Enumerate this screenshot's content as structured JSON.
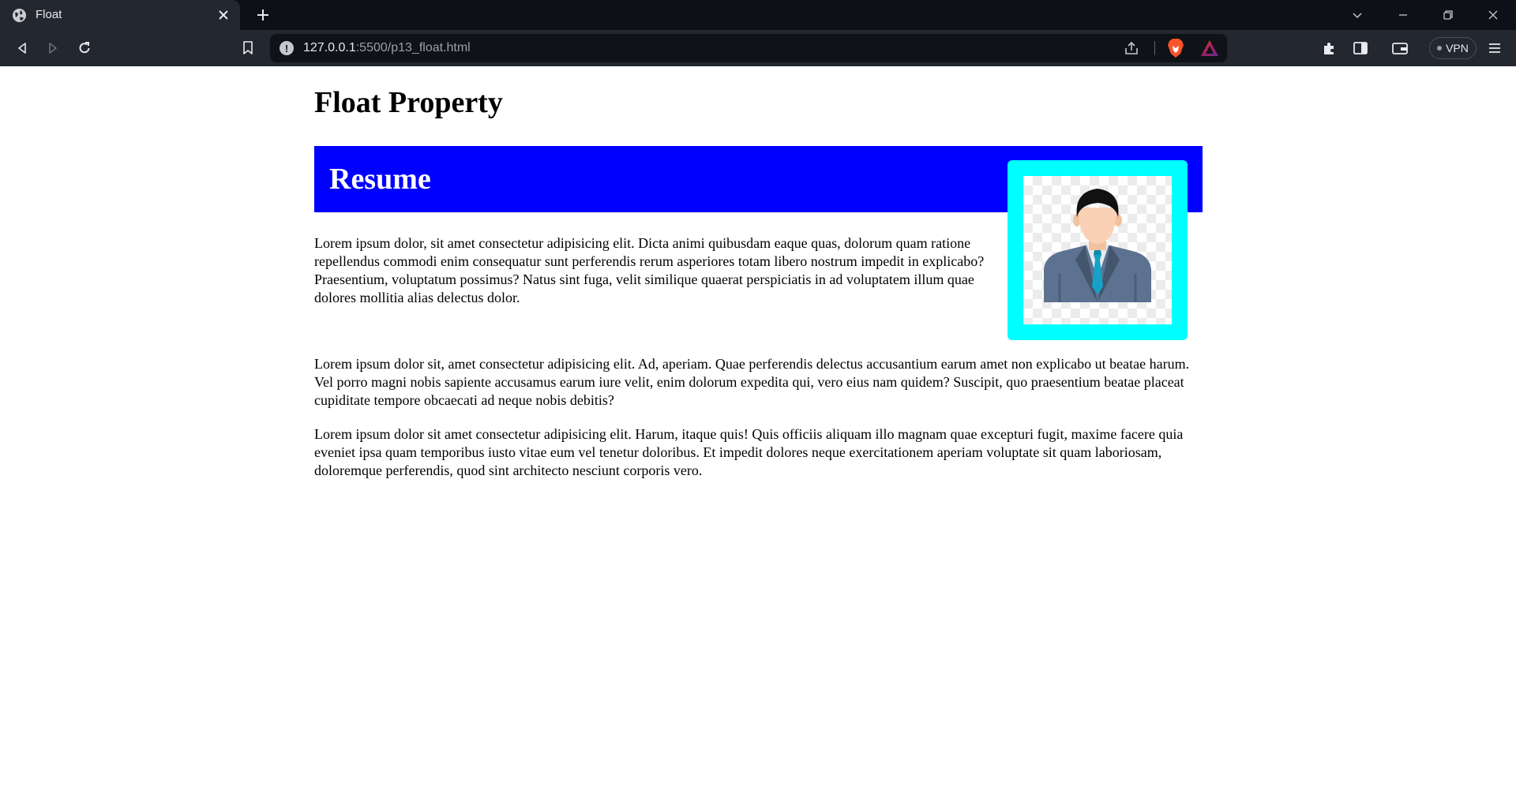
{
  "browser": {
    "tab_title": "Float",
    "url_host": "127.0.0.1",
    "url_rest": ":5500/p13_float.html",
    "vpn_label": "VPN"
  },
  "page": {
    "heading": "Float Property",
    "resume_heading": "Resume",
    "paragraphs": [
      "Lorem ipsum dolor, sit amet consectetur adipisicing elit. Dicta animi quibusdam eaque quas, dolorum quam ratione repellendus commodi enim consequatur sunt perferendis rerum asperiores totam libero nostrum impedit in explicabo? Praesentium, voluptatum possimus? Natus sint fuga, velit similique quaerat perspiciatis in ad voluptatem illum quae dolores mollitia alias delectus dolor.",
      "Lorem ipsum dolor sit, amet consectetur adipisicing elit. Ad, aperiam. Quae perferendis delectus accusantium earum amet non explicabo ut beatae harum. Vel porro magni nobis sapiente accusamus earum iure velit, enim dolorum expedita qui, vero eius nam quidem? Suscipit, quo praesentium beatae placeat cupiditate tempore obcaecati ad neque nobis debitis?",
      "Lorem ipsum dolor sit amet consectetur adipisicing elit. Harum, itaque quis! Quis officiis aliquam illo magnam quae excepturi fugit, maxime facere quia eveniet ipsa quam temporibus iusto vitae eum vel tenetur doloribus. Et impedit dolores neque exercitationem aperiam voluptate sit quam laboriosam, doloremque perferendis, quod sint architecto nesciunt corporis vero."
    ]
  },
  "colors": {
    "resume_bar": "#0000ff",
    "photo_frame": "#00ffff"
  },
  "icons": {
    "tab_favicon": "globe-icon",
    "tab_close": "close-icon",
    "new_tab": "plus-icon",
    "back": "back-icon",
    "forward": "forward-icon",
    "reload": "reload-icon",
    "bookmark": "bookmark-icon",
    "site_info": "info-icon",
    "share": "share-icon",
    "brave_shields": "brave-lion-icon",
    "brave_rewards": "rewards-triangle-icon",
    "extensions": "puzzle-icon",
    "sidebar": "sidebar-icon",
    "wallet": "wallet-icon",
    "menu": "hamburger-menu-icon"
  }
}
